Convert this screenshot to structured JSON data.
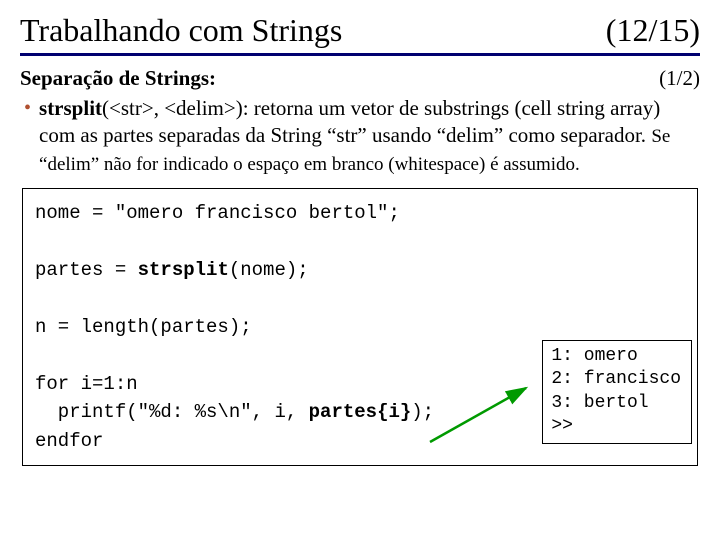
{
  "title": "Trabalhando com Strings",
  "pager": "(12/15)",
  "subheading": "Separação de Strings:",
  "subpager": "(1/2)",
  "bullet": {
    "fn": "strsplit",
    "sig": "(<str>, <delim>): retorna um vetor de substrings (cell string array) com as partes separadas da String “str” usando “delim” como separador. ",
    "tail": "Se “delim” não for indicado o espaço em branco (whitespace) é assumido."
  },
  "code": {
    "l1": "nome = \"omero francisco bertol\";",
    "l2a": "partes = ",
    "l2b": "strsplit",
    "l2c": "(nome);",
    "l3": "n = length(partes);",
    "l4": "for i=1:n",
    "l5a": "  printf(\"%d: %s\\n\", i, ",
    "l5b": "partes{i}",
    "l5c": ");",
    "l6": "endfor"
  },
  "output": "1: omero\n2: francisco\n3: bertol\n>>"
}
